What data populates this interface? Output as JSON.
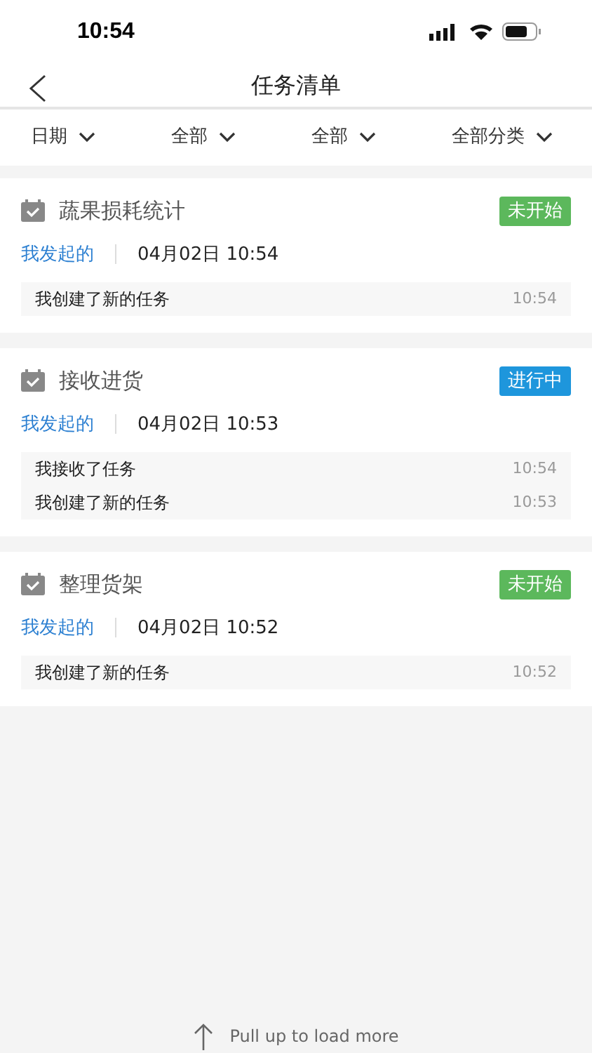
{
  "status_bar": {
    "time": "10:54"
  },
  "nav": {
    "title": "任务清单"
  },
  "filters": [
    {
      "label": "日期"
    },
    {
      "label": "全部"
    },
    {
      "label": "全部"
    },
    {
      "label": "全部分类"
    }
  ],
  "tasks": [
    {
      "title": "蔬果损耗统计",
      "status": {
        "label": "未开始",
        "color": "#5cb85c"
      },
      "origin": "我发起的",
      "datetime": "04月02日 10:54",
      "logs": [
        {
          "text": "我创建了新的任务",
          "time": "10:54"
        }
      ]
    },
    {
      "title": "接收进货",
      "status": {
        "label": "进行中",
        "color": "#1e96dc"
      },
      "origin": "我发起的",
      "datetime": "04月02日 10:53",
      "logs": [
        {
          "text": "我接收了任务",
          "time": "10:54"
        },
        {
          "text": "我创建了新的任务",
          "time": "10:53"
        }
      ]
    },
    {
      "title": "整理货架",
      "status": {
        "label": "未开始",
        "color": "#5cb85c"
      },
      "origin": "我发起的",
      "datetime": "04月02日 10:52",
      "logs": [
        {
          "text": "我创建了新的任务",
          "time": "10:52"
        }
      ]
    }
  ],
  "footer": {
    "hint": "Pull up to load more"
  }
}
